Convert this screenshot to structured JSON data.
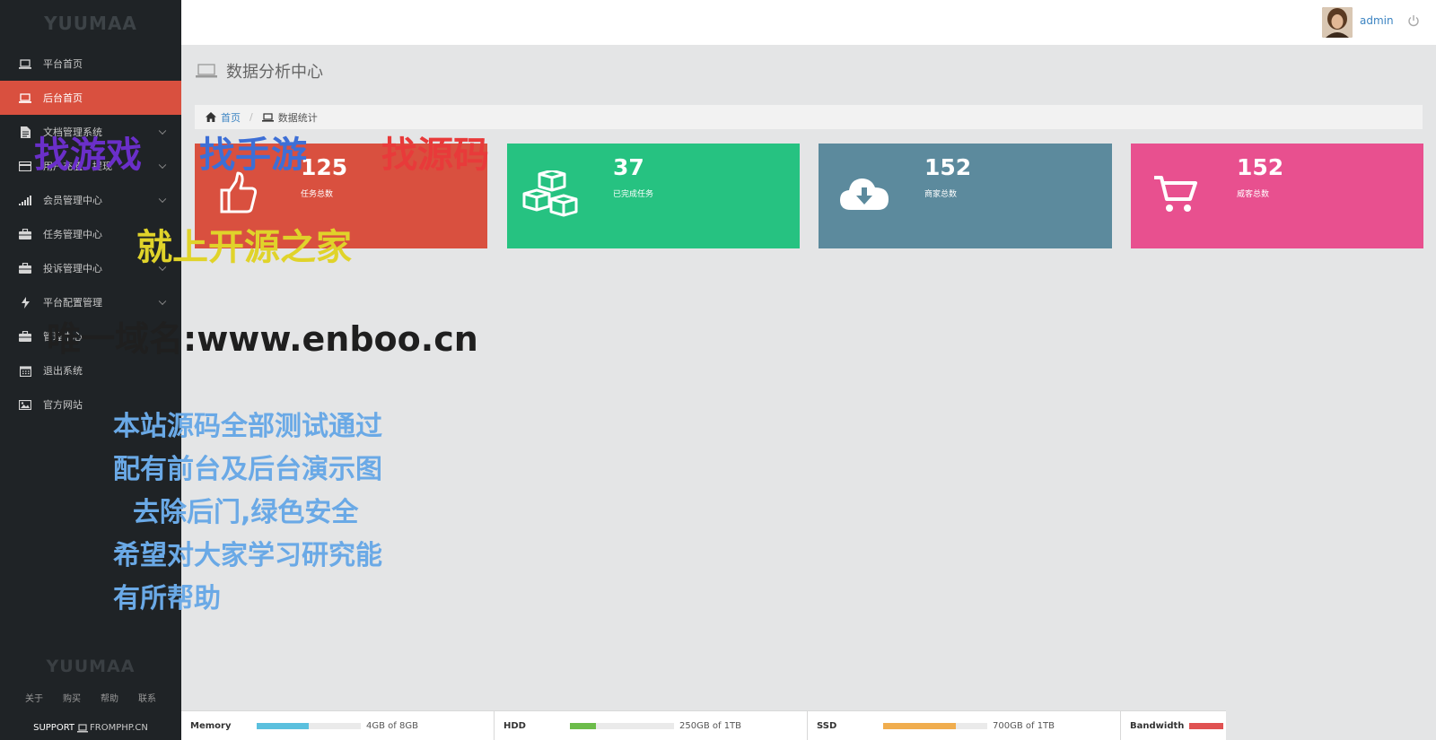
{
  "sidebar": {
    "brand": "YUUMAA",
    "items": [
      {
        "label": "平台首页",
        "icon": "laptop-icon",
        "has_submenu": false
      },
      {
        "label": "后台首页",
        "icon": "laptop-icon",
        "has_submenu": false,
        "active": true
      },
      {
        "label": "文档管理系统",
        "icon": "file-icon",
        "has_submenu": true
      },
      {
        "label": "用户充值、提现",
        "icon": "card-icon",
        "has_submenu": true
      },
      {
        "label": "会员管理中心",
        "icon": "signal-icon",
        "has_submenu": true
      },
      {
        "label": "任务管理中心",
        "icon": "briefcase-icon",
        "has_submenu": false
      },
      {
        "label": "投诉管理中心",
        "icon": "briefcase-icon",
        "has_submenu": true
      },
      {
        "label": "平台配置管理",
        "icon": "bolt-icon",
        "has_submenu": true
      },
      {
        "label": "管理中心",
        "icon": "briefcase-icon",
        "has_submenu": false
      },
      {
        "label": "退出系统",
        "icon": "calendar-icon",
        "has_submenu": false
      },
      {
        "label": "官方网站",
        "icon": "picture-icon",
        "has_submenu": false
      }
    ],
    "footer_brand": "YUUMAA",
    "footer_links": [
      "关于",
      "购买",
      "帮助",
      "联系"
    ],
    "support_label": "SUPPORT",
    "support_site": "FROMPHP.CN"
  },
  "topbar": {
    "username": "admin"
  },
  "page": {
    "title": "数据分析中心"
  },
  "breadcrumb": {
    "home": "首页",
    "current": "数据统计"
  },
  "cards": [
    {
      "value": "125",
      "label": "任务总数",
      "color": "#d9503f",
      "icon": "thumbs-up-icon"
    },
    {
      "value": "37",
      "label": "已完成任务",
      "color": "#26c281",
      "icon": "cubes-icon"
    },
    {
      "value": "152",
      "label": "商家总数",
      "color": "#5c8a9d",
      "icon": "cloud-download-icon"
    },
    {
      "value": "152",
      "label": "威客总数",
      "color": "#e8508f",
      "icon": "cart-icon"
    }
  ],
  "watermark": {
    "line1a": "找游戏",
    "line1b": "找手游",
    "line1c": "找源码",
    "line2": "就上开源之家",
    "line3": "唯一域名:www.enboo.cn",
    "line4": "本站源码全部测试通过",
    "line5": "配有前台及后台演示图",
    "line6": "去除后门,绿色安全",
    "line7": "希望对大家学习研究能",
    "line8": "有所帮助"
  },
  "status": [
    {
      "name": "Memory",
      "value": "4GB of 8GB",
      "fraction": 0.5,
      "color": "#5bc0de"
    },
    {
      "name": "HDD",
      "value": "250GB of 1TB",
      "fraction": 0.25,
      "color": "#6cbc4a"
    },
    {
      "name": "SSD",
      "value": "700GB of 1TB",
      "fraction": 0.7,
      "color": "#f0ad4e"
    },
    {
      "name": "Bandwidth",
      "value": "",
      "fraction": 1.0,
      "color": "#e05252"
    }
  ]
}
